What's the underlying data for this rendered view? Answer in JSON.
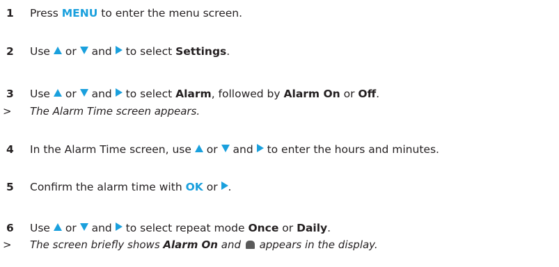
{
  "steps": [
    {
      "number": "1",
      "press": "Press",
      "menu": "MENU",
      "rest": "to enter the menu screen."
    },
    {
      "number": "2",
      "use": "Use",
      "or": "or",
      "and": "and",
      "to_select": "to select",
      "target": "Settings",
      "end": "."
    },
    {
      "number": "3",
      "use": "Use",
      "or": "or",
      "and": "and",
      "to_select": "to select",
      "target": "Alarm",
      "followed": ", followed by",
      "opt1": "Alarm On",
      "or2": "or",
      "opt2": "Off",
      "end": "."
    },
    {
      "number": "4",
      "lead": "In the Alarm Time screen, use",
      "or": "or",
      "and": "and",
      "rest": "to enter the hours and minutes."
    },
    {
      "number": "5",
      "lead": "Confirm the alarm time with",
      "ok": "OK",
      "or": "or",
      "end": "."
    },
    {
      "number": "6",
      "use": "Use",
      "or": "or",
      "and": "and",
      "rest": "to select repeat mode",
      "opt1": "Once",
      "or2": "or",
      "opt2": "Daily",
      "end": "."
    }
  ],
  "results": {
    "symbol": ">",
    "r1": "The Alarm Time screen appears.",
    "r2_lead": "The screen briefly shows",
    "r2_bold": "Alarm On",
    "r2_and": "and",
    "r2_end": "appears in the display."
  },
  "icons": {
    "up": "up-arrow-icon",
    "down": "down-arrow-icon",
    "right": "right-arrow-icon",
    "alarm": "alarm-bell-icon"
  },
  "colors": {
    "accent": "#1aa0dd",
    "text": "#231f20"
  }
}
